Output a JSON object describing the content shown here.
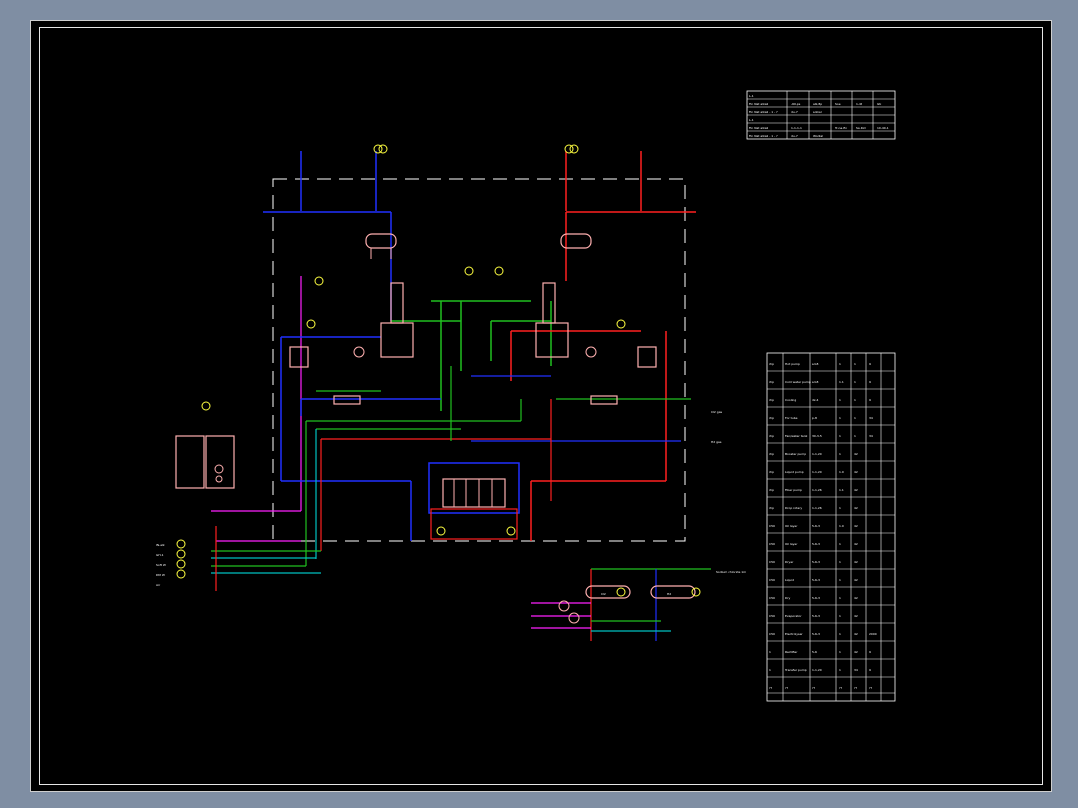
{
  "colors": {
    "background": "#000000",
    "frame": "#e6e6e6",
    "hot_line": "#ff2020",
    "cold_line": "#2030ff",
    "green_line": "#20c020",
    "cyan_line": "#00c0c0",
    "magenta_line": "#ff20ff",
    "equipment": "#ffb0b0",
    "instrument": "#ffff40",
    "text": "#ffffff"
  },
  "top_table": {
    "rows": [
      [
        "L-1",
        "F",
        "L",
        "L",
        "T",
        "T",
        "T"
      ],
      [
        "Fin Nat alkali",
        "-60,ps",
        "alk,8p",
        "Soe",
        "1-4t",
        "Izk",
        ""
      ],
      [
        "Fin Nat alkali - 1 - ?",
        "du-7",
        "solkal",
        "",
        "",
        "",
        ""
      ],
      [
        "L-1",
        "F",
        "F",
        "L",
        "L",
        "T",
        "T"
      ],
      [
        "Fin Nat alkali",
        "1-1-1-1",
        "",
        "Tr-na-fin",
        "Sa.Rid",
        "10-40-1",
        ""
      ],
      [
        "Fin Nat alkali - 1 - ?",
        "du-7",
        "Wodial",
        "",
        "",
        "",
        ""
      ]
    ]
  },
  "equipment_list": {
    "rows": [
      [
        "rhp",
        "Hot pump",
        "sd-8",
        "1",
        "1",
        "9"
      ],
      [
        "rhp",
        "Cold water pump",
        "sd-8",
        "1.1",
        "1",
        "9"
      ],
      [
        "rhp",
        "Cooling",
        "dz-4",
        "1",
        "1",
        "9"
      ],
      [
        "rhp",
        "For tube",
        "p-8",
        "1",
        "1",
        "34"
      ],
      [
        "rhp",
        "Fan/water tank",
        "30-3-5",
        "1",
        "1",
        "34"
      ],
      [
        "rhp",
        "Booster pump",
        "1-1,20",
        "1",
        "42",
        ""
      ],
      [
        "rhp",
        "Liquid pump",
        "1-1,20",
        "1.0",
        "42",
        ""
      ],
      [
        "rhp",
        "Fiber pump",
        "1-1,26",
        "1.1",
        "42",
        ""
      ],
      [
        "rhp",
        "Drop rotary",
        "1-1,26",
        "1",
        "42",
        ""
      ],
      [
        "C50",
        "Oil layer",
        "5-6-3",
        "1.0",
        "42",
        ""
      ],
      [
        "C50",
        "Oil layer",
        "5-6-3",
        "1",
        "42",
        ""
      ],
      [
        "C50",
        "Dryer",
        "5-6-3",
        "1",
        "42",
        ""
      ],
      [
        "C50",
        "Liquid",
        "5-6-3",
        "1",
        "42",
        ""
      ],
      [
        "C50",
        "Dry",
        "5-6-3",
        "1",
        "42",
        ""
      ],
      [
        "C50",
        "Evaporator",
        "5-6-3",
        "1",
        "42",
        ""
      ],
      [
        "C50",
        "Electrolyser",
        "5-6-3",
        "1",
        "42",
        "2000"
      ],
      [
        "1",
        "Rectifier",
        "5-6",
        "1",
        "42",
        "9"
      ],
      [
        "1",
        "Transfer pump",
        "1-1,20",
        "1",
        "34",
        "9"
      ],
      [
        "??",
        "??",
        "??",
        "??",
        "??",
        "??"
      ]
    ]
  },
  "labels": {
    "left_inputs": [
      "IN-alk",
      "GH-1",
      "Soft W",
      "DM W",
      "Air"
    ],
    "right_outputs": [
      "Cl2 gas",
      "H2 gas"
    ],
    "lower_right_note": "Sodium chloride 1m",
    "drum_tags": [
      "Cl2",
      "H2"
    ]
  }
}
